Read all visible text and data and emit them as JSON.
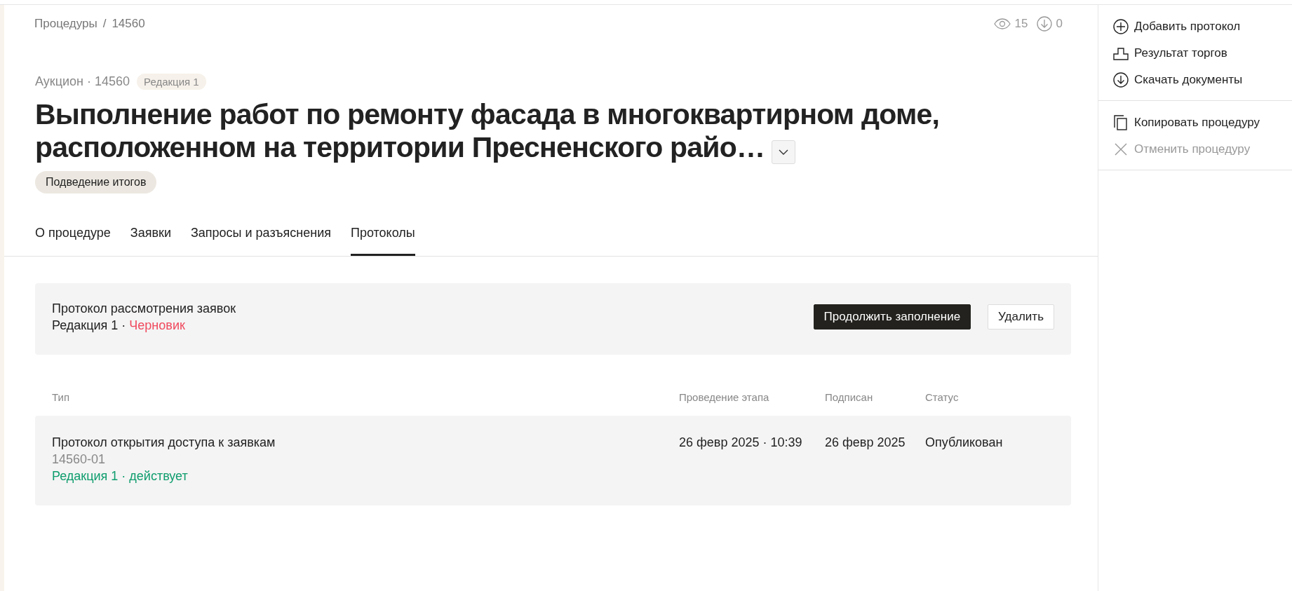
{
  "breadcrumbs": [
    {
      "label": "Процедуры"
    },
    {
      "label": "14560"
    }
  ],
  "breadcrumb_separator": "/",
  "counters": [
    {
      "kind": "views",
      "value": "15"
    },
    {
      "kind": "downloads",
      "value": "0"
    }
  ],
  "header": {
    "subtitle": "Аукцион · 14560",
    "edition": "Редакция 1",
    "title": "Выполнение работ по ремонту фасада в многоквартирном доме, расположенном на территории Пресненского райо…",
    "expanded": false,
    "stage": "Подведение итогов"
  },
  "tabs": [
    {
      "label": "О процедуре",
      "selected": false
    },
    {
      "label": "Заявки",
      "selected": false
    },
    {
      "label": "Запросы и разъяснения",
      "selected": false
    },
    {
      "label": "Протоколы",
      "selected": true
    }
  ],
  "draft": {
    "title": "Протокол рассмотрения заявок",
    "edition": "Редакция 1 · ",
    "status": {
      "text": "Черновик",
      "color": "#f04a5e"
    },
    "buttons": [
      {
        "label": "Продолжить заполнение",
        "kind": "primary"
      },
      {
        "label": "Удалить",
        "kind": "secondary"
      }
    ]
  },
  "table": {
    "columns": [
      "Тип",
      "Проведение этапа",
      "Подписан",
      "Статус"
    ],
    "rows": [
      {
        "title": "Протокол открытия доступа к заявкам",
        "number": "14560-01",
        "edition": {
          "text": "Редакция 1 · действует",
          "color": "#0f9d6e"
        },
        "stage_time": "26 февр 2025 · 10:39",
        "signed": "26 февр 2025",
        "status": "Опубликован"
      }
    ]
  },
  "sidebar": {
    "groups": [
      [
        {
          "kind": "plus",
          "label": "Добавить протокол",
          "disabled": false
        },
        {
          "kind": "podium",
          "label": "Результат торгов",
          "disabled": false
        },
        {
          "kind": "download",
          "label": "Скачать документы",
          "disabled": false
        }
      ],
      [
        {
          "kind": "copy",
          "label": "Копировать процедуру",
          "disabled": false
        },
        {
          "kind": "cross",
          "label": "Отменить процедуру",
          "disabled": true
        }
      ]
    ]
  }
}
